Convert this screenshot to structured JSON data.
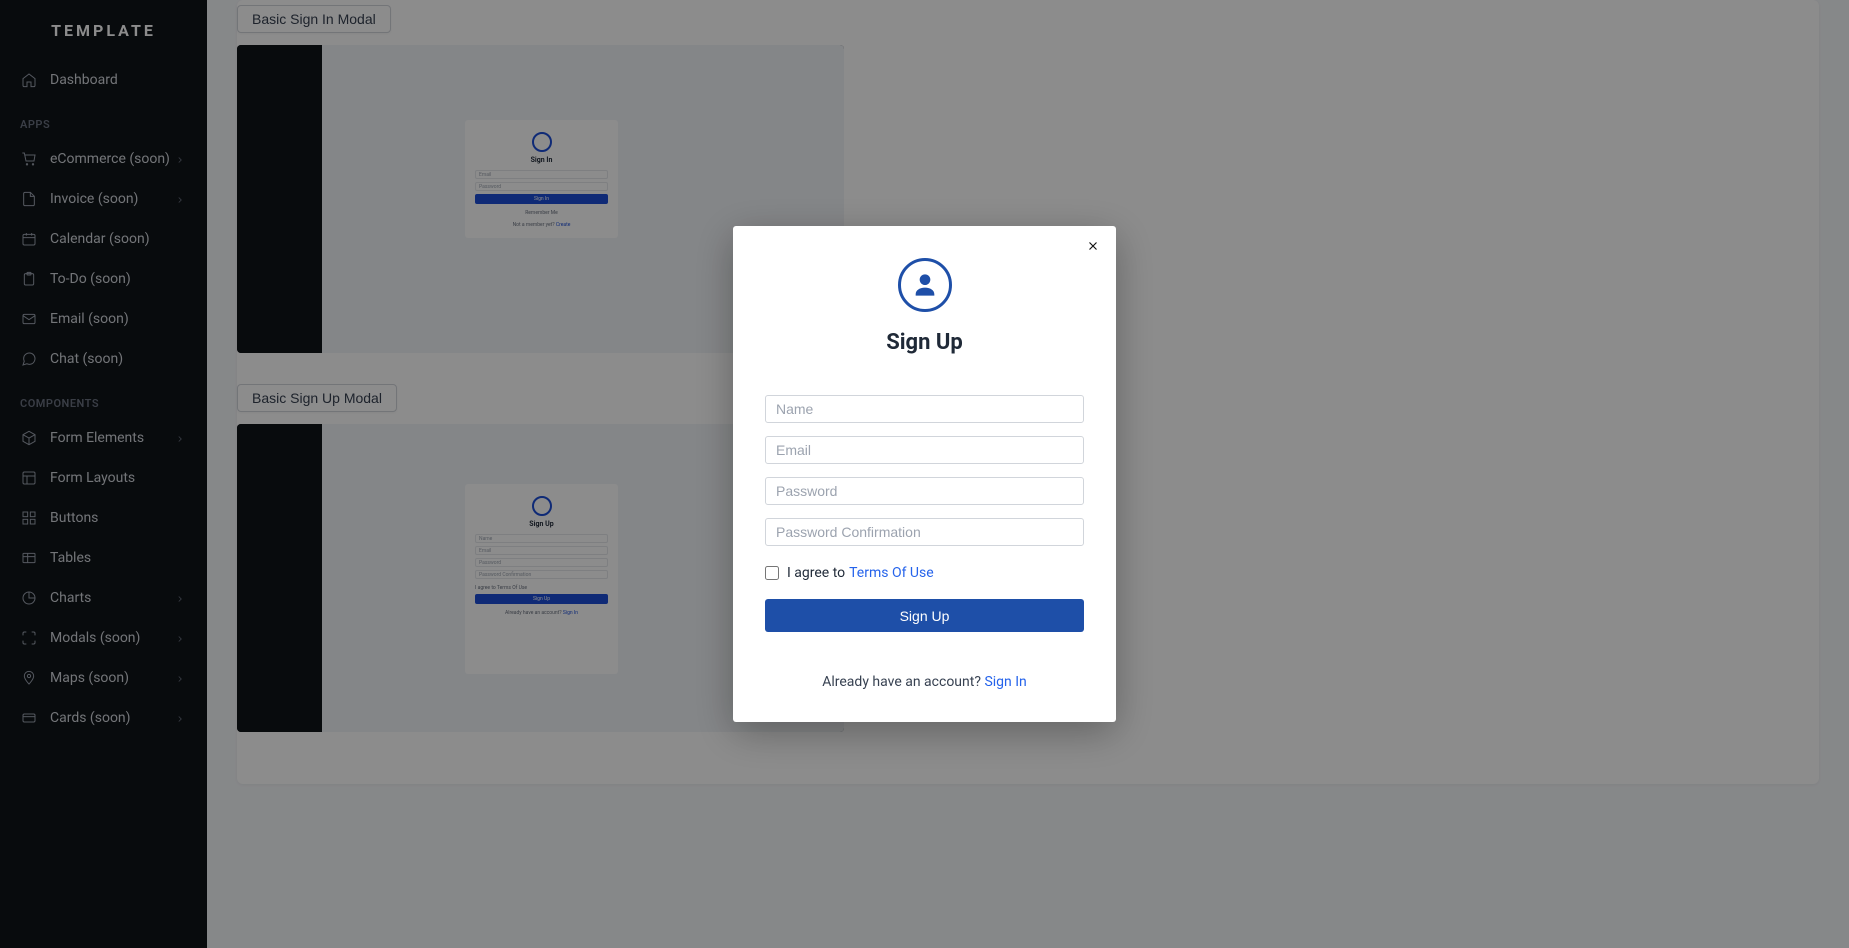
{
  "brand": "TEMPLATE",
  "sidebar": {
    "dashboard": "Dashboard",
    "sections": {
      "apps": "APPS",
      "components": "COMPONENTS"
    },
    "apps": [
      {
        "label": "eCommerce (soon)",
        "icon": "cart",
        "expandable": true
      },
      {
        "label": "Invoice (soon)",
        "icon": "file",
        "expandable": true
      },
      {
        "label": "Calendar (soon)",
        "icon": "calendar",
        "expandable": false
      },
      {
        "label": "To-Do (soon)",
        "icon": "clipboard",
        "expandable": false
      },
      {
        "label": "Email (soon)",
        "icon": "mail",
        "expandable": false
      },
      {
        "label": "Chat (soon)",
        "icon": "chat",
        "expandable": false
      }
    ],
    "components": [
      {
        "label": "Form Elements",
        "icon": "box",
        "expandable": true
      },
      {
        "label": "Form Layouts",
        "icon": "layout",
        "expandable": false
      },
      {
        "label": "Buttons",
        "icon": "grid",
        "expandable": false
      },
      {
        "label": "Tables",
        "icon": "table",
        "expandable": false
      },
      {
        "label": "Charts",
        "icon": "pie",
        "expandable": true
      },
      {
        "label": "Modals (soon)",
        "icon": "expand",
        "expandable": true
      },
      {
        "label": "Maps (soon)",
        "icon": "pin",
        "expandable": true
      },
      {
        "label": "Cards (soon)",
        "icon": "card",
        "expandable": true
      }
    ]
  },
  "main": {
    "buttons": {
      "signin": "Basic Sign In Modal",
      "signup": "Basic Sign Up Modal"
    }
  },
  "modal": {
    "title": "Sign Up",
    "fields": {
      "name": "Name",
      "email": "Email",
      "password": "Password",
      "password_confirm": "Password Confirmation"
    },
    "agree_prefix": "I agree to",
    "terms_link": "Terms Of Use",
    "submit": "Sign Up",
    "footer_text": "Already have an account?",
    "footer_link": "Sign In"
  },
  "preview": {
    "signin": {
      "title": "Sign In",
      "email": "Email",
      "password": "Password",
      "button": "Sign In",
      "remember": "Remember Me",
      "footer": "Not a member yet?",
      "footer_link": "Create"
    },
    "signup": {
      "title": "Sign Up",
      "name": "Name",
      "email": "Email",
      "password": "Password",
      "confirm": "Password Confirmation",
      "agree": "I agree to Terms Of Use",
      "button": "Sign Up",
      "footer": "Already have an account?",
      "footer_link": "Sign In"
    }
  }
}
